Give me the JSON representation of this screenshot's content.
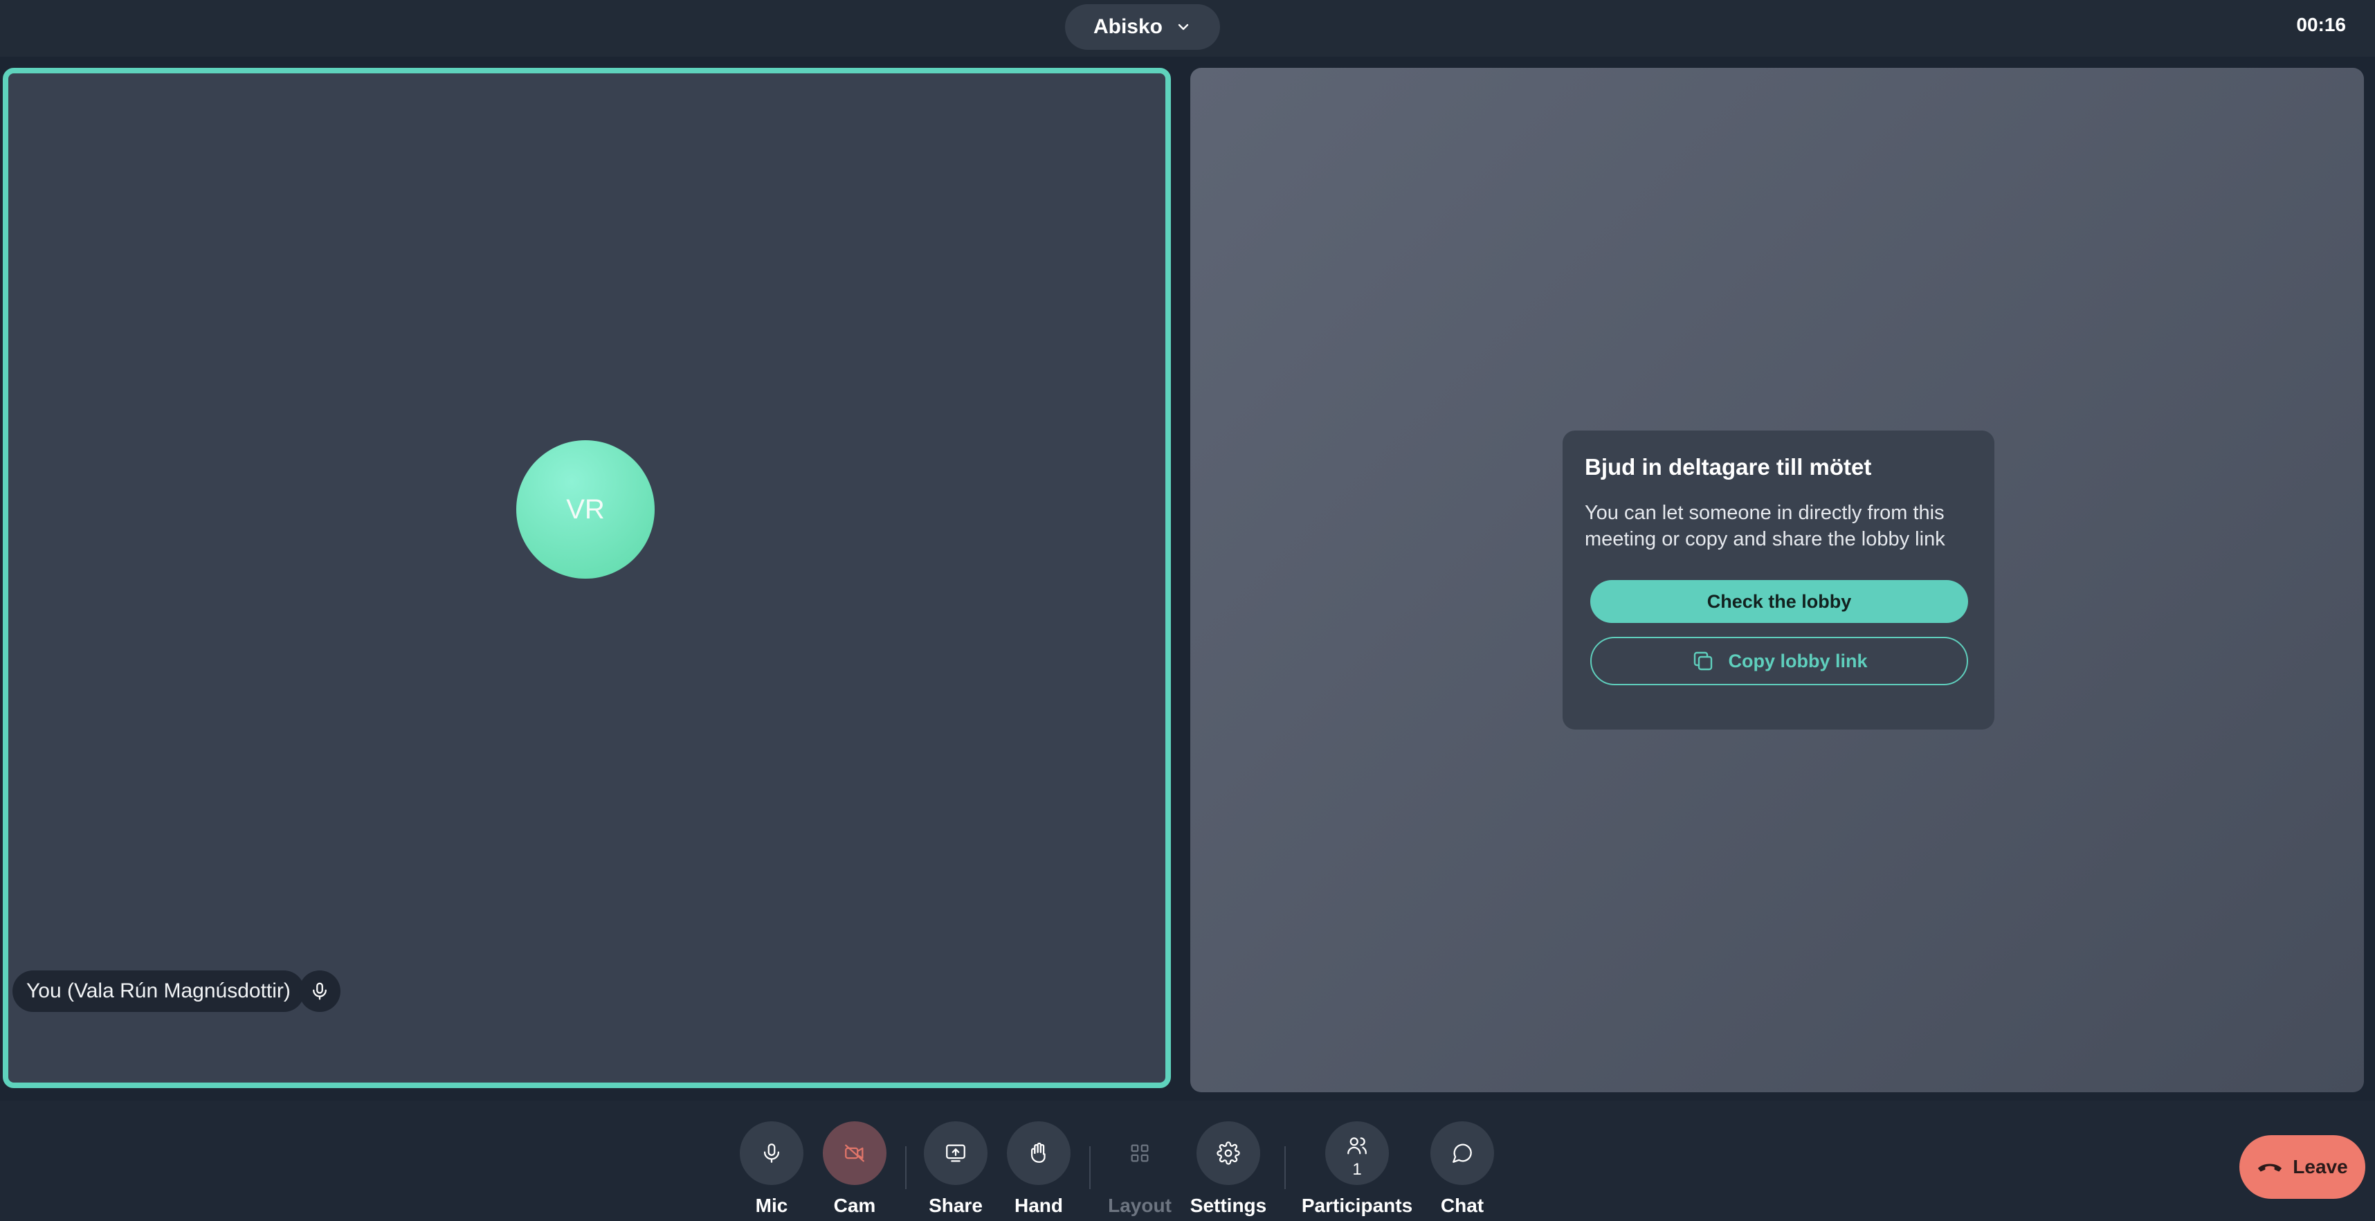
{
  "header": {
    "room_name": "Abisko",
    "timer": "00:16"
  },
  "self_tile": {
    "initials": "VR",
    "name_tag": "You (Vala Rún Magnúsdottir)"
  },
  "invite_card": {
    "title": "Bjud in deltagare till mötet",
    "body": "You can let someone in directly from this meeting or copy and share the lobby link",
    "check_lobby_label": "Check the lobby",
    "copy_link_label": "Copy lobby link"
  },
  "toolbar": {
    "mic": "Mic",
    "cam": "Cam",
    "share": "Share",
    "hand": "Hand",
    "layout": "Layout",
    "settings": "Settings",
    "participants": "Participants",
    "participants_count": "1",
    "chat": "Chat",
    "leave": "Leave"
  },
  "colors": {
    "accent": "#5fcfbd",
    "leave": "#ef7b6d",
    "cam_off": "#e1766a"
  }
}
